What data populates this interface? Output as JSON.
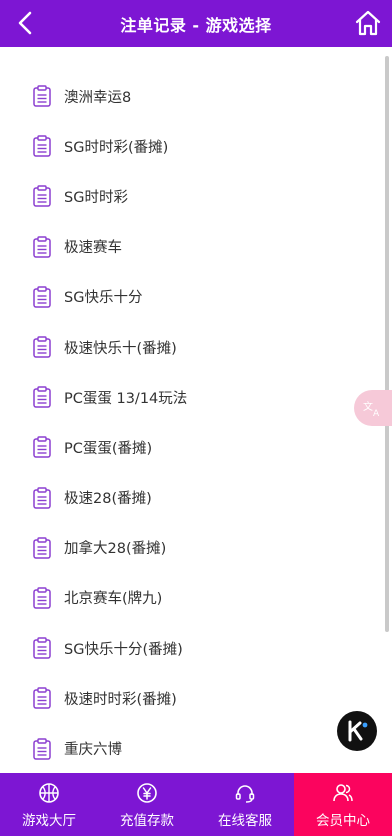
{
  "header": {
    "title": "注单记录 - 游戏选择",
    "bg_color": "#7d16d3"
  },
  "games": [
    "澳洲幸运8",
    "SG时时彩(番摊)",
    "SG时时彩",
    "极速赛车",
    "SG快乐十分",
    "极速快乐十(番摊)",
    "PC蛋蛋 13/14玩法",
    "PC蛋蛋(番摊)",
    "极速28(番摊)",
    "加拿大28(番摊)",
    "北京赛车(牌九)",
    "SG快乐十分(番摊)",
    "极速时时彩(番摊)",
    "重庆六博"
  ],
  "item_icon": "document-icon",
  "tabs": [
    {
      "label": "游戏大厅",
      "icon": "basketball-icon",
      "active": false
    },
    {
      "label": "充值存款",
      "icon": "yen-coin-icon",
      "active": false
    },
    {
      "label": "在线客服",
      "icon": "headset-icon",
      "active": false
    },
    {
      "label": "会员中心",
      "icon": "members-icon",
      "active": true
    }
  ],
  "colors": {
    "accent": "#7d16d3",
    "active_tab": "#fb045e",
    "icon_purple": "#8b3fd0"
  }
}
